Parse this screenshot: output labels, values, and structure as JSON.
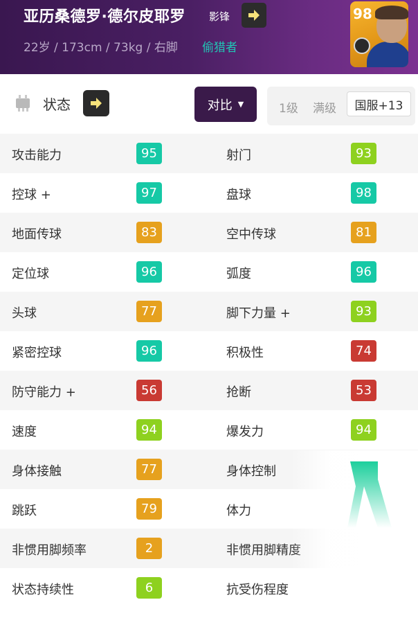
{
  "header": {
    "name": "亚历桑德罗·德尔皮耶罗",
    "position": "影锋",
    "info": "22岁 / 173cm / 73kg / 右脚",
    "style": "偷猎者",
    "card_rating": "98"
  },
  "controls": {
    "status_label": "状态",
    "compare_label": "对比",
    "level1": "1级",
    "level_max": "满级",
    "server": "国服+13"
  },
  "colors": {
    "teal": "#16c9a6",
    "green": "#8ed11f",
    "orange": "#e6a11e",
    "red": "#c93a33",
    "header_bg": "#4a1f63"
  },
  "stats": [
    {
      "left": {
        "label": "攻击能力",
        "value": "95",
        "color": "#16c9a6"
      },
      "right": {
        "label": "射门",
        "value": "93",
        "color": "#8ed11f"
      }
    },
    {
      "left": {
        "label": "控球 +",
        "value": "97",
        "color": "#16c9a6"
      },
      "right": {
        "label": "盘球",
        "value": "98",
        "color": "#16c9a6"
      }
    },
    {
      "left": {
        "label": "地面传球",
        "value": "83",
        "color": "#e6a11e"
      },
      "right": {
        "label": "空中传球",
        "value": "81",
        "color": "#e6a11e"
      }
    },
    {
      "left": {
        "label": "定位球",
        "value": "96",
        "color": "#16c9a6"
      },
      "right": {
        "label": "弧度",
        "value": "96",
        "color": "#16c9a6"
      }
    },
    {
      "left": {
        "label": "头球",
        "value": "77",
        "color": "#e6a11e"
      },
      "right": {
        "label": "脚下力量 +",
        "value": "93",
        "color": "#8ed11f"
      }
    },
    {
      "left": {
        "label": "紧密控球",
        "value": "96",
        "color": "#16c9a6"
      },
      "right": {
        "label": "积极性",
        "value": "74",
        "color": "#c93a33"
      }
    },
    {
      "left": {
        "label": "防守能力 +",
        "value": "56",
        "color": "#c93a33"
      },
      "right": {
        "label": "抢断",
        "value": "53",
        "color": "#c93a33"
      }
    },
    {
      "left": {
        "label": "速度",
        "value": "94",
        "color": "#8ed11f"
      },
      "right": {
        "label": "爆发力",
        "value": "94",
        "color": "#8ed11f"
      }
    },
    {
      "left": {
        "label": "身体接触",
        "value": "77",
        "color": "#e6a11e"
      },
      "right": {
        "label": "身体控制",
        "value": "",
        "color": ""
      }
    },
    {
      "left": {
        "label": "跳跃",
        "value": "79",
        "color": "#e6a11e"
      },
      "right": {
        "label": "体力",
        "value": "",
        "color": ""
      }
    },
    {
      "left": {
        "label": "非惯用脚频率",
        "value": "2",
        "color": "#e6a11e"
      },
      "right": {
        "label": "非惯用脚精度",
        "value": "",
        "color": ""
      }
    },
    {
      "left": {
        "label": "状态持续性",
        "value": "6",
        "color": "#8ed11f"
      },
      "right": {
        "label": "抗受伤程度",
        "value": "",
        "color": ""
      }
    }
  ]
}
